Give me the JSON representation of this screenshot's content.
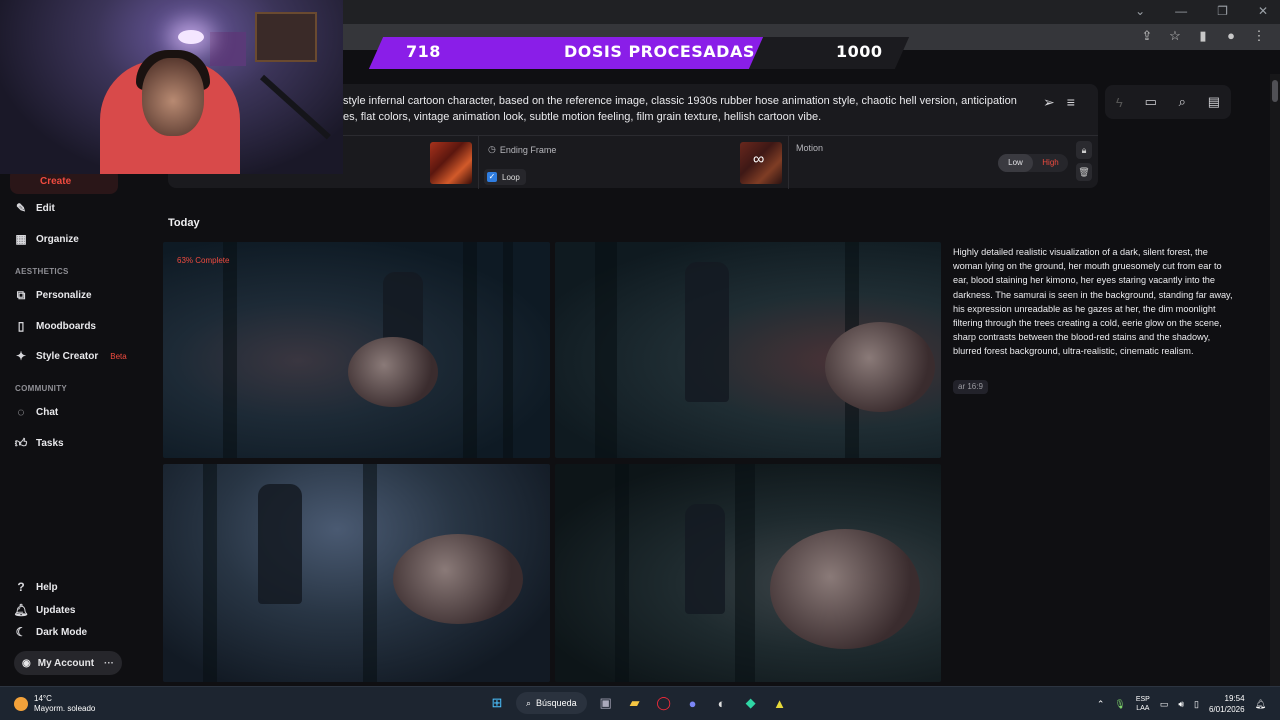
{
  "browser": {
    "window_controls": [
      "⌄",
      "—",
      "❐",
      "✕"
    ],
    "extension_icons": [
      "share-icon",
      "star-icon",
      "sidebar-icon",
      "profile-icon",
      "menu-icon"
    ]
  },
  "banner": {
    "processed": "718",
    "label": "DOSIS PROCESADAS",
    "total": "1000"
  },
  "sidebar": {
    "items": [
      {
        "label": "Create",
        "icon": "brush-icon",
        "active": true
      },
      {
        "label": "Edit",
        "icon": "edit-icon"
      },
      {
        "label": "Organize",
        "icon": "grid-icon"
      }
    ],
    "aesthetics_label": "AESTHETICS",
    "aesthetics": [
      {
        "label": "Personalize",
        "icon": "personalize-icon"
      },
      {
        "label": "Moodboards",
        "icon": "moodboard-icon"
      },
      {
        "label": "Style Creator",
        "icon": "style-icon",
        "badge": "Beta"
      }
    ],
    "community_label": "COMMUNITY",
    "community": [
      {
        "label": "Chat",
        "icon": "chat-icon"
      },
      {
        "label": "Tasks",
        "icon": "tasks-icon"
      }
    ],
    "bottom": [
      {
        "label": "Help",
        "icon": "help-icon"
      },
      {
        "label": "Updates",
        "icon": "bell-icon"
      },
      {
        "label": "Dark Mode",
        "icon": "moon-icon"
      }
    ],
    "account": "My Account"
  },
  "prompt": {
    "line1": "style infernal cartoon character, based on the reference image, classic 1930s rubber hose animation style, chaotic hell version, anticipation",
    "line2": "es, flat colors, vintage animation look, subtle motion feeling, film grain texture, hellish cartoon vibe.",
    "ending_frame_label": "Ending Frame",
    "loop_label": "Loop",
    "motion_label": "Motion",
    "motion_low": "Low",
    "motion_high": "High"
  },
  "content": {
    "section_title": "Today",
    "progress": "63% Complete",
    "description": "Highly detailed realistic visualization of a dark, silent forest, the woman lying on the ground, her mouth gruesomely cut from ear to ear, blood staining her kimono, her eyes staring vacantly into the darkness. The samurai is seen in the background, standing far away, his expression unreadable as he gazes at her, the dim moonlight filtering through the trees creating a cold, eerie glow on the scene, sharp contrasts between the blood-red stains and the shadowy, blurred forest background, ultra-realistic, cinematic realism.",
    "aspect_ratio": "ar 16:9"
  },
  "taskbar": {
    "temperature": "14°C",
    "weather": "Mayorm. soleado",
    "search": "Búsqueda",
    "lang1": "ESP",
    "lang2": "LAA",
    "time": "19:54",
    "date": "6/01/2026"
  },
  "colors": {
    "accent": "#ef4b3f",
    "banner_purple": "#8a1ee8",
    "bg": "#0f0f12"
  }
}
